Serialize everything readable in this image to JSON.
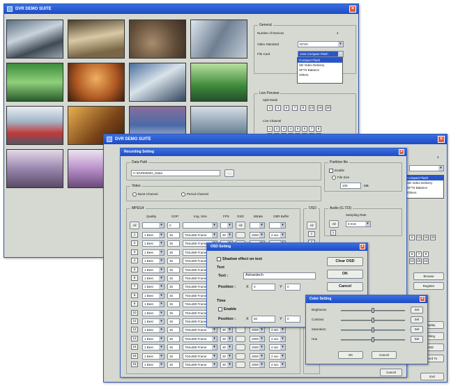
{
  "main_window": {
    "title": "DVR DEMO SUITE"
  },
  "general": {
    "group": "General",
    "num_devices_label": "Number of Devices",
    "num_devices_value": "4",
    "video_standard_label": "Video Standard",
    "video_standard_value": "NTSC",
    "file_card_label": "File Card",
    "file_card_value": "Auto Compact Flash",
    "file_card_options": [
      "Auto Compact Flash",
      "Compact Flash",
      "SD Video Delivery",
      "SFTS Balance",
      "Others"
    ]
  },
  "live_preview": {
    "group": "Live Preview",
    "split_mode_label": "Split Mode",
    "split_modes": [
      "1",
      "4",
      "6",
      "7",
      "9",
      "13",
      "16",
      "20"
    ],
    "live_channel_label": "Live Channel",
    "channels_row1": [
      "1",
      "2",
      "3",
      "4",
      "5",
      "6",
      "7",
      "8"
    ],
    "channels_row2": [
      "9",
      "10",
      "11",
      "12",
      "13",
      "14",
      "15",
      "16"
    ]
  },
  "second_window": {
    "title": "DVR DEMO SUITE",
    "num_devices_value": "4"
  },
  "recording": {
    "title": "Recording Setting",
    "data_path_label": "Data Path",
    "data_path_value": "C:\\DVRDEMO_Data\\",
    "browse_label": "...",
    "partition_group": "Partition file",
    "enable_label": "Enable",
    "file_size_label": "File Size",
    "file_size_value": "100",
    "file_size_unit": "MB",
    "video_group": "Video",
    "burst_label": "Burst Channel",
    "period_label": "Period Channel",
    "mpeg4_group": "MPEG4",
    "osd_group": "OSD",
    "audio_group": "Audio (G.723)",
    "sampling_label": "Sampling Rate",
    "sampling_value": "8 KHz",
    "col_quality": "Quality",
    "col_gop": "GOP",
    "col_size": "Img. Size",
    "col_fps": "FPS",
    "col_osd": "OSD",
    "col_bitrate": "Bitrate",
    "col_buffer": "CBR Buffer",
    "all_label": "All",
    "all_gop": "0",
    "rows": [
      {
        "ch": "1",
        "q": "1 Best",
        "gop": "25",
        "size": "704x480 Frame",
        "fps": "30",
        "br": "2000",
        "buf": "2 sec"
      },
      {
        "ch": "2",
        "q": "1 Best",
        "gop": "25",
        "size": "704x480 Frame",
        "fps": "30",
        "br": "2000",
        "buf": "2 sec"
      },
      {
        "ch": "3",
        "q": "1 Best",
        "gop": "25",
        "size": "704x480 Frame",
        "fps": "30",
        "br": "2000",
        "buf": "2 sec"
      },
      {
        "ch": "4",
        "q": "1 Best",
        "gop": "25",
        "size": "704x480 Frame",
        "fps": "30",
        "br": "2000",
        "buf": "2 sec"
      },
      {
        "ch": "5",
        "q": "1 Best",
        "gop": "25",
        "size": "704x480 Frame",
        "fps": "30",
        "br": "2000",
        "buf": "2 sec"
      },
      {
        "ch": "6",
        "q": "1 Best",
        "gop": "25",
        "size": "704x480 Frame",
        "fps": "30",
        "br": "2000",
        "buf": "2 sec"
      },
      {
        "ch": "7",
        "q": "1 Best",
        "gop": "25",
        "size": "704x480 Frame",
        "fps": "30",
        "br": "2000",
        "buf": "2 sec"
      },
      {
        "ch": "8",
        "q": "1 Best",
        "gop": "25",
        "size": "704x480 Frame",
        "fps": "30",
        "br": "2000",
        "buf": "2 sec"
      },
      {
        "ch": "9",
        "q": "1 Best",
        "gop": "25",
        "size": "704x480 Frame",
        "fps": "30",
        "br": "2000",
        "buf": "2 sec"
      },
      {
        "ch": "10",
        "q": "1 Best",
        "gop": "25",
        "size": "704x480 Frame",
        "fps": "30",
        "br": "2000",
        "buf": "2 sec"
      },
      {
        "ch": "11",
        "q": "1 Best",
        "gop": "25",
        "size": "704x480 Frame",
        "fps": "30",
        "br": "2000",
        "buf": "2 sec"
      },
      {
        "ch": "12",
        "q": "1 Best",
        "gop": "25",
        "size": "704x480 Frame",
        "fps": "30",
        "br": "2000",
        "buf": "2 sec"
      },
      {
        "ch": "13",
        "q": "1 Best",
        "gop": "25",
        "size": "704x480 Frame",
        "fps": "30",
        "br": "2000",
        "buf": "2 sec"
      },
      {
        "ch": "14",
        "q": "1 Best",
        "gop": "25",
        "size": "704x480 Frame",
        "fps": "30",
        "br": "2000",
        "buf": "2 sec"
      },
      {
        "ch": "15",
        "q": "1 Best",
        "gop": "25",
        "size": "704x480 Frame",
        "fps": "30",
        "br": "2000",
        "buf": "2 sec"
      },
      {
        "ch": "16",
        "q": "1 Best",
        "gop": "25",
        "size": "704x480 Frame",
        "fps": "30",
        "br": "2000",
        "buf": "2 sec"
      }
    ],
    "cancel_label": "Cancel"
  },
  "osd": {
    "title": "OSD Setting",
    "shadow_label": "Shadow effect on text",
    "text_group": "Text",
    "text_label": "Text :",
    "text_value": "Advantech",
    "position_label": "Position :",
    "x_label": "X",
    "y_label": "Y",
    "text_x": "0",
    "text_y": "0",
    "time_group": "Time",
    "enable_label": "Enable",
    "time_x": "60",
    "time_y": "0",
    "clear_label": "Clear OSD",
    "ok_label": "OK",
    "cancel_label": "Cancel"
  },
  "color": {
    "title": "Color Setting",
    "items": [
      {
        "label": "Brightness",
        "value": 0.5
      },
      {
        "label": "Contrast",
        "value": 0.5
      },
      {
        "label": "Saturation",
        "value": 0.5
      },
      {
        "label": "Hue",
        "value": 0.5
      }
    ],
    "set_label": "Set",
    "ok_label": "OK",
    "cancel_label": "Cancel"
  },
  "side_buttons": {
    "browse": "Browse",
    "register": "Register",
    "display": "Display",
    "setting": "Setting",
    "osd": "OSD",
    "record": "Record To",
    "exit": "Exit"
  },
  "colors": {
    "titlebar": "#1d4bc4",
    "window_bg": "#d6d9d2",
    "close": "#e0573a"
  }
}
